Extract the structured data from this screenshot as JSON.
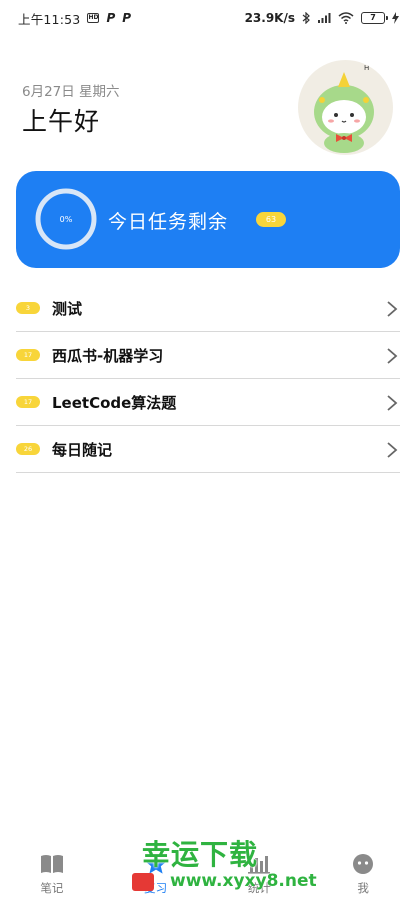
{
  "status_bar": {
    "time": "上午11:53",
    "notif_box": "HD",
    "notif_p1": "P",
    "notif_p2": "P",
    "net_speed": "23.9K/s",
    "battery_level": "7"
  },
  "header": {
    "date": "6月27日 星期六",
    "greeting": "上午好",
    "avatar_icon": "dinosaur-avatar"
  },
  "progress_card": {
    "percent_label": "0%",
    "progress_fraction": 0,
    "title": "今日任务剩余",
    "remaining_count": "63",
    "color": "#1e7ff3"
  },
  "task_lists": [
    {
      "count": "3",
      "title": "测试"
    },
    {
      "count": "17",
      "title": "西瓜书-机器学习"
    },
    {
      "count": "17",
      "title": "LeetCode算法题"
    },
    {
      "count": "26",
      "title": "每日随记"
    }
  ],
  "bottom_nav": [
    {
      "label": "笔记",
      "icon": "book-icon"
    },
    {
      "label": "复习",
      "icon": "star-icon"
    },
    {
      "label": "统计",
      "icon": "bar-chart-icon"
    },
    {
      "label": "我",
      "icon": "face-icon"
    }
  ],
  "watermark": {
    "title": "幸运下载",
    "url": "www.xyxy8.net"
  },
  "colors": {
    "accent": "#1e7ff3",
    "badge": "#f8d53a",
    "watermark": "#2fb340"
  }
}
